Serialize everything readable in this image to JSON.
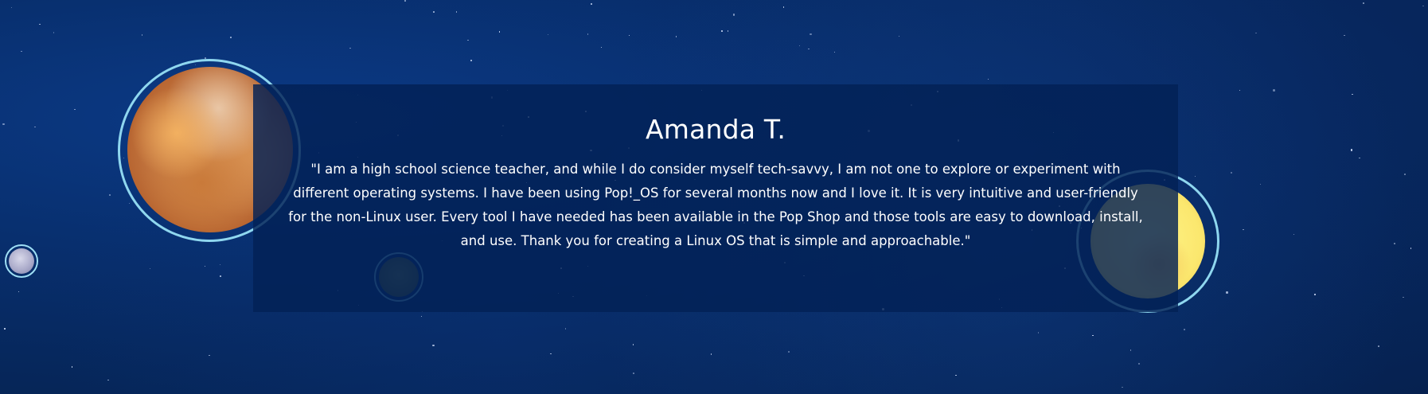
{
  "testimonial": {
    "name": "Amanda T.",
    "quote": "\"I am a high school science teacher, and while I do consider myself tech-savvy, I am not one to explore or experiment with different operating systems. I have been using Pop!_OS for several months now and I love it. It is very intuitive and user-friendly for the non-Linux user. Every tool I have needed has been available in the Pop Shop and those tools are easy to download, install, and use. Thank you for creating a Linux OS that is simple and approachable.\""
  },
  "colors": {
    "background": "#062659",
    "card": "#032156",
    "ring": "#8fd7ef",
    "text": "#ffffff"
  }
}
